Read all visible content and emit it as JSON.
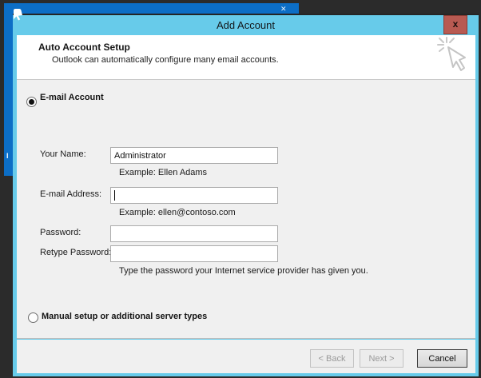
{
  "background_window": {
    "close_glyph": "✕",
    "text_fragment": "l"
  },
  "dialog": {
    "title": "Add Account",
    "close_glyph": "x",
    "header": {
      "title": "Auto Account Setup",
      "subtitle": "Outlook can automatically configure many email accounts."
    },
    "options": [
      {
        "label": "E-mail Account",
        "selected": true
      },
      {
        "label": "Manual setup or additional server types",
        "selected": false
      }
    ],
    "fields": [
      {
        "label": "Your Name:",
        "value": "Administrator",
        "hint": "Example: Ellen Adams"
      },
      {
        "label": "E-mail Address:",
        "value": "",
        "hint": "Example: ellen@contoso.com"
      },
      {
        "label": "Password:",
        "value": ""
      },
      {
        "label": "Retype Password:",
        "value": ""
      }
    ],
    "password_help": "Type the password your Internet service provider has given you.",
    "buttons": {
      "back": "< Back",
      "next": "Next >",
      "cancel": "Cancel"
    }
  },
  "colors": {
    "background": "#2B2B2B",
    "background_window_blue": "#0C6EC6",
    "dialog_chrome": "#67CBEA",
    "close_button": "#B85A52",
    "header_bg": "#FFFFFF",
    "body_bg": "#F0F0F0"
  }
}
